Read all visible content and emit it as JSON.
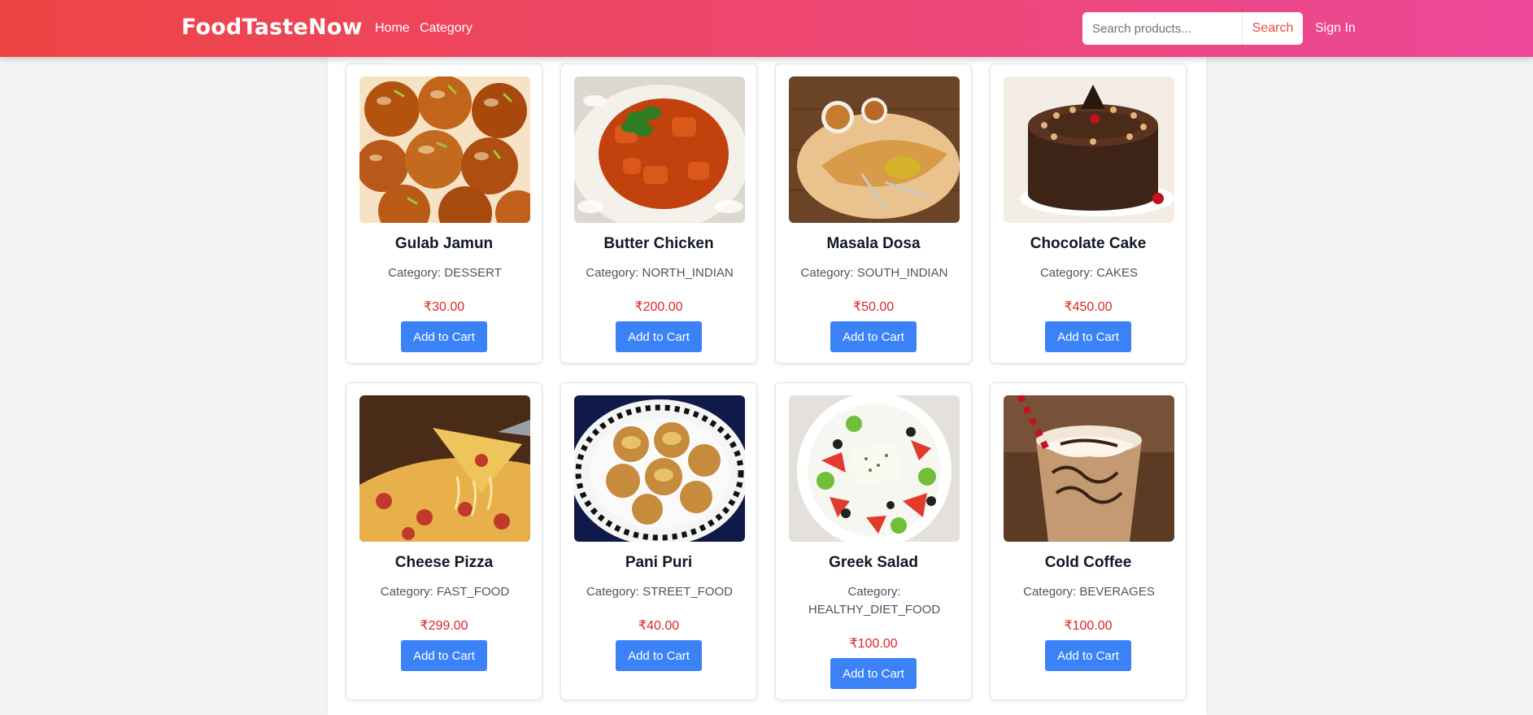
{
  "header": {
    "brand": "FoodTasteNow",
    "nav": {
      "home": "Home",
      "category": "Category"
    },
    "search": {
      "placeholder": "Search products...",
      "button": "Search"
    },
    "signin": "Sign In"
  },
  "colors": {
    "header_gradient_start": "#ef4444",
    "header_gradient_end": "#ec4899",
    "button_blue": "#3b82f6",
    "price_red": "#dc2626"
  },
  "products": [
    {
      "name": "Gulab Jamun",
      "category": "Category: DESSERT",
      "price": "₹30.00",
      "button": "Add to Cart",
      "image": "gulab-jamun-image"
    },
    {
      "name": "Butter Chicken",
      "category": "Category: NORTH_INDIAN",
      "price": "₹200.00",
      "button": "Add to Cart",
      "image": "butter-chicken-image"
    },
    {
      "name": "Masala Dosa",
      "category": "Category: SOUTH_INDIAN",
      "price": "₹50.00",
      "button": "Add to Cart",
      "image": "masala-dosa-image"
    },
    {
      "name": "Chocolate Cake",
      "category": "Category: CAKES",
      "price": "₹450.00",
      "button": "Add to Cart",
      "image": "chocolate-cake-image"
    },
    {
      "name": "Cheese Pizza",
      "category": "Category: FAST_FOOD",
      "price": "₹299.00",
      "button": "Add to Cart",
      "image": "cheese-pizza-image"
    },
    {
      "name": "Pani Puri",
      "category": "Category: STREET_FOOD",
      "price": "₹40.00",
      "button": "Add to Cart",
      "image": "pani-puri-image"
    },
    {
      "name": "Greek Salad",
      "category": "Category: HEALTHY_DIET_FOOD",
      "price": "₹100.00",
      "button": "Add to Cart",
      "image": "greek-salad-image"
    },
    {
      "name": "Cold Coffee",
      "category": "Category: BEVERAGES",
      "price": "₹100.00",
      "button": "Add to Cart",
      "image": "cold-coffee-image"
    }
  ]
}
